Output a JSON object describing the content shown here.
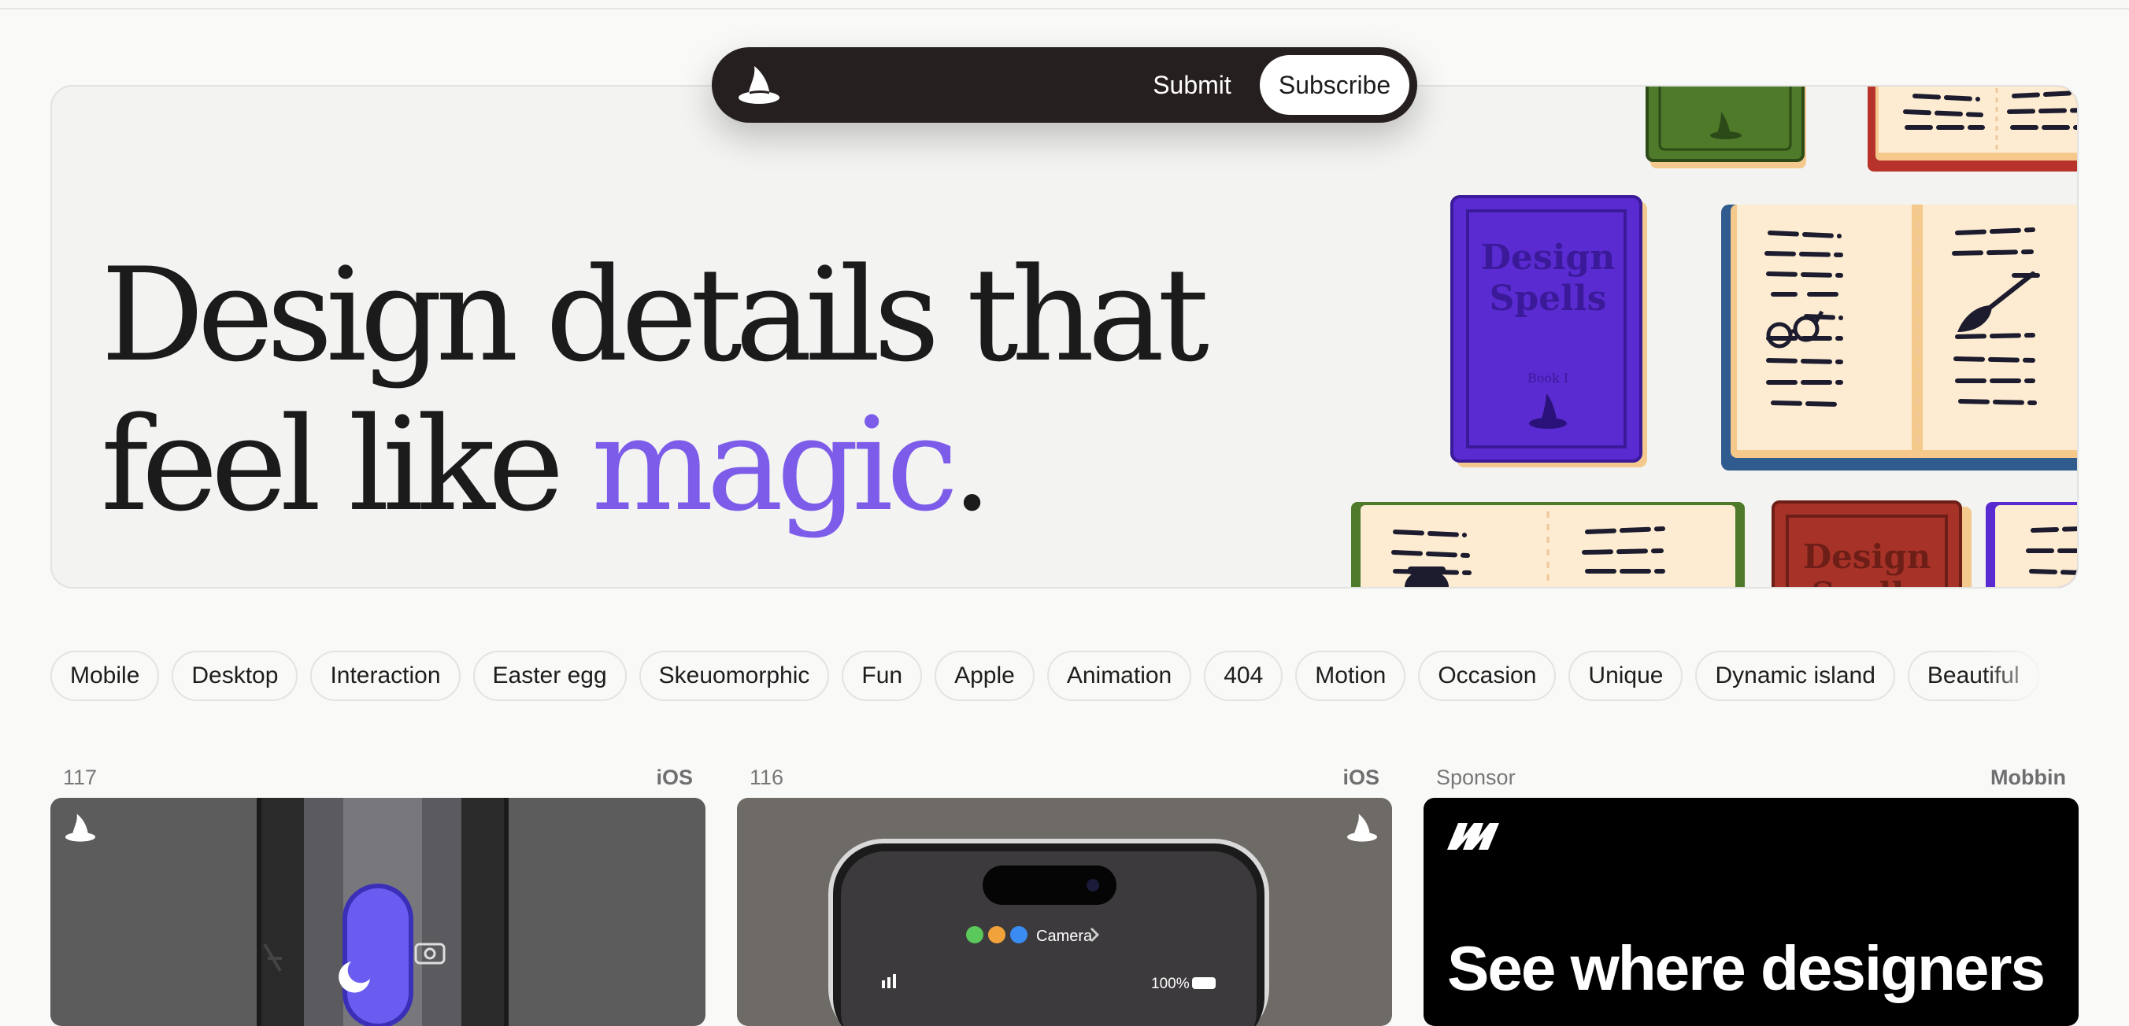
{
  "nav": {
    "submit_label": "Submit",
    "subscribe_label": "Subscribe",
    "logo_icon": "wizard-hat-icon"
  },
  "hero": {
    "title_line1": "Design details that",
    "title_line2_start": "feel like ",
    "title_accent": "magic",
    "title_end": ".",
    "accent_color": "#7c5ce8",
    "illustration": {
      "book_cover_title": "Design Spells",
      "book_subtitle": "Book I",
      "red_book_title": "Design Spells"
    }
  },
  "tags": [
    "Mobile",
    "Desktop",
    "Interaction",
    "Easter egg",
    "Skeuomorphic",
    "Fun",
    "Apple",
    "Animation",
    "404",
    "Motion",
    "Occasion",
    "Unique",
    "Dynamic island",
    "Beautiful"
  ],
  "cards": [
    {
      "number": "117",
      "platform": "iOS"
    },
    {
      "number": "116",
      "platform": "iOS",
      "status": {
        "camera_label": "Camera",
        "battery": "100%"
      }
    },
    {
      "number": "Sponsor",
      "platform": "Mobbin",
      "headline": "See where designers"
    }
  ]
}
